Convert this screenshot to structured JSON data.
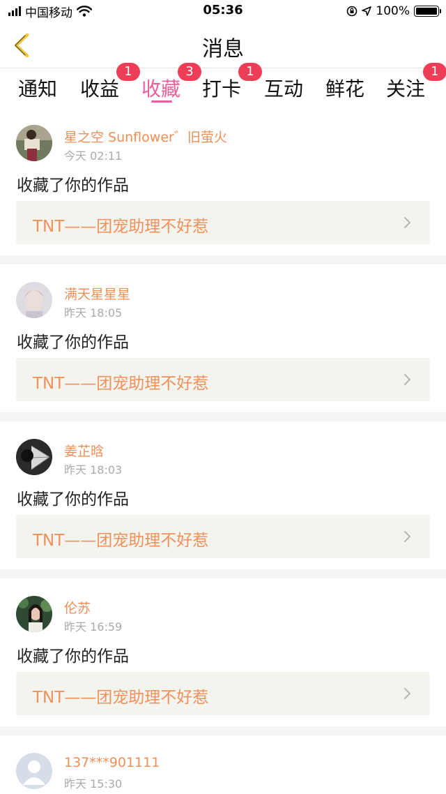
{
  "status_bar": {
    "carrier": "中国移动",
    "time": "05:36",
    "battery": "100%"
  },
  "header": {
    "title": "消息"
  },
  "tabs": [
    {
      "label": "通知",
      "badge": ""
    },
    {
      "label": "收益",
      "badge": "1"
    },
    {
      "label": "收藏",
      "badge": "3",
      "active": true
    },
    {
      "label": "打卡",
      "badge": "1"
    },
    {
      "label": "互动",
      "badge": ""
    },
    {
      "label": "鲜花",
      "badge": ""
    },
    {
      "label": "关注",
      "badge": "1"
    }
  ],
  "feed": [
    {
      "user": "星之空 Sunflower゛旧萤火",
      "time": "今天 02:11",
      "action": "收藏了你的作品",
      "work": "TNT——团宠助理不好惹"
    },
    {
      "user": "满天星星星",
      "time": "昨天 18:05",
      "action": "收藏了你的作品",
      "work": "TNT——团宠助理不好惹"
    },
    {
      "user": "姜芷晗",
      "time": "昨天 18:03",
      "action": "收藏了你的作品",
      "work": "TNT——团宠助理不好惹"
    },
    {
      "user": "伦苏",
      "time": "昨天 16:59",
      "action": "收藏了你的作品",
      "work": "TNT——团宠助理不好惹"
    },
    {
      "user": "137***901111",
      "time": "昨天 15:30"
    }
  ],
  "colors": {
    "accent_pink": "#ee5f9a",
    "badge_red": "#ee3e57",
    "name_orange": "#ef8f58",
    "back_arrow_yellow": "#f2c531"
  },
  "icons": [
    "signal-icon",
    "wifi-icon",
    "lock-rotation-icon",
    "location-icon",
    "battery-icon",
    "back-arrow-icon",
    "chevron-right-icon"
  ]
}
